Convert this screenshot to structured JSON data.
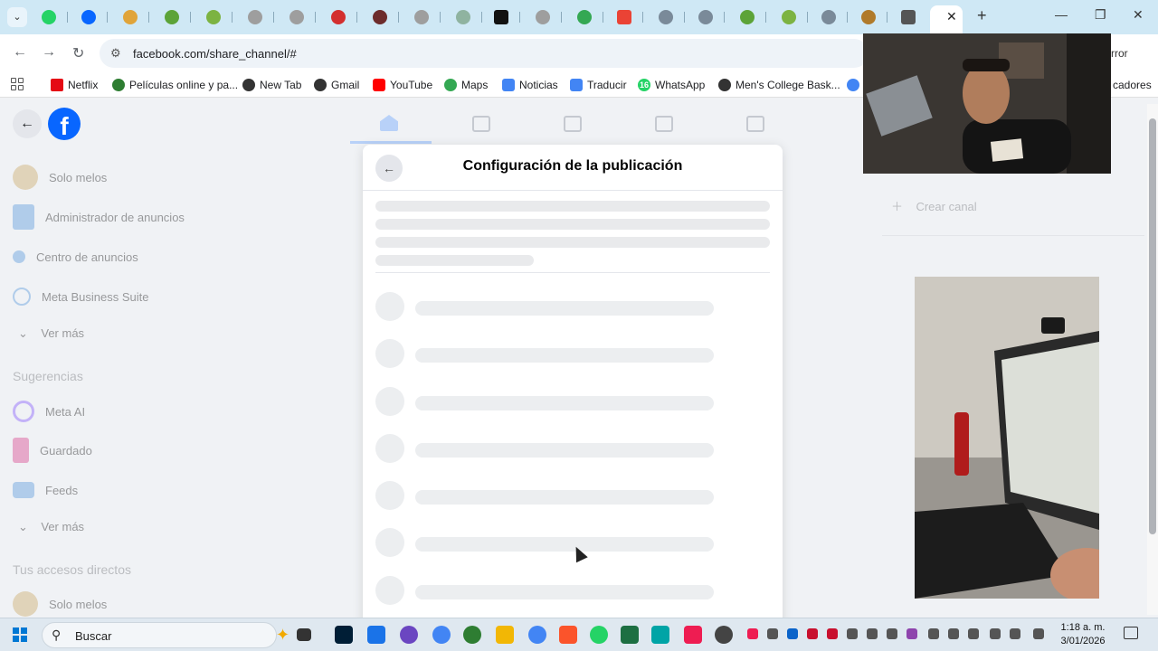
{
  "browser": {
    "url": "facebook.com/share_channel/#",
    "addr_right_text": "rror",
    "bookmarks_right_text": "cadores",
    "bookmarks": [
      {
        "label": "Netflix",
        "icon": "netflix-icon",
        "color": "#e50914"
      },
      {
        "label": "Películas online y pa...",
        "icon": "movies-icon",
        "color": "#2e7d32"
      },
      {
        "label": "New Tab",
        "icon": "globe-icon",
        "color": "#333333"
      },
      {
        "label": "Gmail",
        "icon": "globe-icon",
        "color": "#333333"
      },
      {
        "label": "YouTube",
        "icon": "youtube-icon",
        "color": "#ff0000"
      },
      {
        "label": "Maps",
        "icon": "maps-icon",
        "color": "#34a853"
      },
      {
        "label": "Noticias",
        "icon": "news-icon",
        "color": "#4285f4"
      },
      {
        "label": "Traducir",
        "icon": "translate-icon",
        "color": "#4285f4"
      },
      {
        "label": "WhatsApp",
        "icon": "whatsapp-icon",
        "color": "#25d366",
        "badge": "16"
      },
      {
        "label": "Men's College Bask...",
        "icon": "globe-icon",
        "color": "#333333"
      }
    ]
  },
  "facebook": {
    "sidebar": {
      "items1": [
        "Solo melos",
        "Administrador de anuncios",
        "Centro de anuncios",
        "Meta Business Suite"
      ],
      "more": "Ver más",
      "suggestions_heading": "Sugerencias",
      "items2": [
        "Meta AI",
        "Guardado",
        "Feeds"
      ],
      "shortcuts_heading": "Tus accesos directos",
      "shortcut": "Solo melos"
    },
    "right_panel": {
      "create_channel": "Crear canal"
    },
    "modal": {
      "title": "Configuración de la publicación"
    }
  },
  "taskbar": {
    "search_placeholder": "Buscar",
    "time": "1:18 a. m.",
    "date": "3/01/2026"
  },
  "colors": {
    "facebook_blue": "#0866ff",
    "tabbar": "#cfe8f5",
    "skeleton": "#eceef0"
  }
}
